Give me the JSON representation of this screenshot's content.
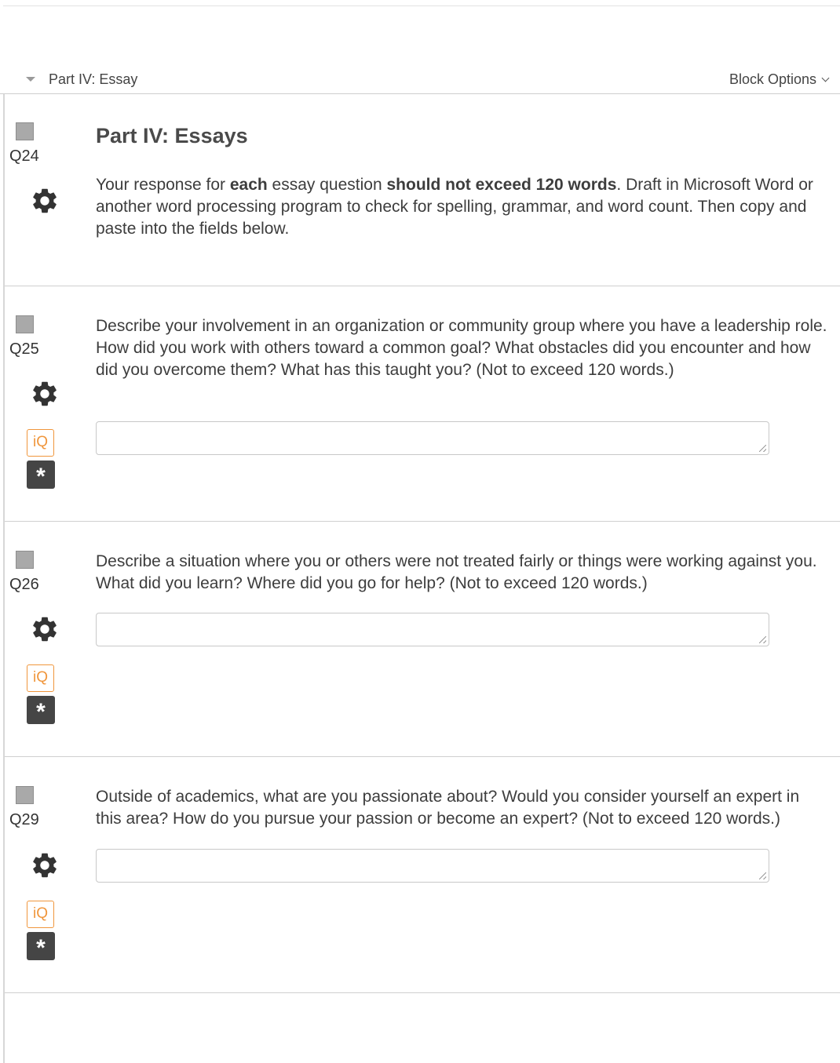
{
  "block": {
    "title": "Part IV: Essay",
    "options_label": "Block Options"
  },
  "questions": [
    {
      "id": "Q24",
      "heading": "Part IV: Essays",
      "intro": {
        "t1": "Your response for ",
        "b1": "each",
        "t2": " essay question ",
        "b2": "should not exceed 120 words",
        "t3": ". Draft in Microsoft Word or another word processing program to check for spelling, grammar, and word count. Then copy and paste into the fields below."
      }
    },
    {
      "id": "Q25",
      "text": "Describe your involvement in an organization or community group where you have a leadership role. How did you work with others toward a common goal? What obstacles did you encounter and how did you overcome them? What has this taught you? (Not to exceed 120 words.)",
      "answer": ""
    },
    {
      "id": "Q26",
      "text": "Describe a situation where you or others were not treated fairly or things were working against you. What did you learn? Where did you go for help? (Not to exceed 120 words.)",
      "answer": ""
    },
    {
      "id": "Q29",
      "text": "Outside of academics, what are you passionate about? Would you consider yourself an expert in this area? How do you pursue your passion or become an expert? (Not to exceed 120 words.)",
      "answer": ""
    }
  ],
  "icons": {
    "iq": "iQ",
    "required": "*",
    "gear": "gear-icon",
    "caret": "caret-down-icon"
  },
  "colors": {
    "iq_accent": "#f0963c",
    "required_bg": "#454545",
    "checkbox": "#a9a9a9"
  }
}
